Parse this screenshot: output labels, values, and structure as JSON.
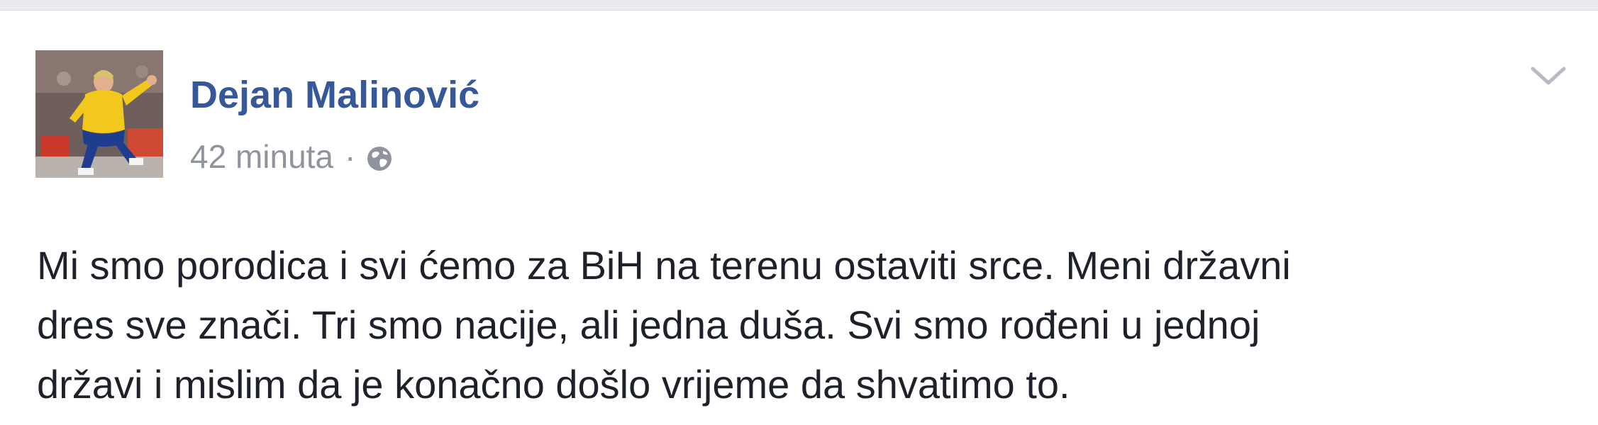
{
  "post": {
    "author_name": "Dejan Malinović",
    "timestamp": "42 minuta",
    "separator": "·",
    "privacy_icon": "globe-icon",
    "menu_icon": "chevron-down-icon",
    "avatar": "profile-photo",
    "text_lines": [
      "Mi smo porodica i svi ćemo za BiH na terenu ostaviti srce. Meni državni",
      "dres sve znači. Tri smo nacije, ali jedna duša. Svi smo rođeni u jednoj",
      "državi i mislim da je konačno došlo vrijeme da shvatimo to."
    ]
  },
  "colors": {
    "page_background": "#e9ebee",
    "card_background": "#ffffff",
    "author_link": "#365899",
    "meta_text": "#90949c",
    "body_text": "#1d2129"
  }
}
